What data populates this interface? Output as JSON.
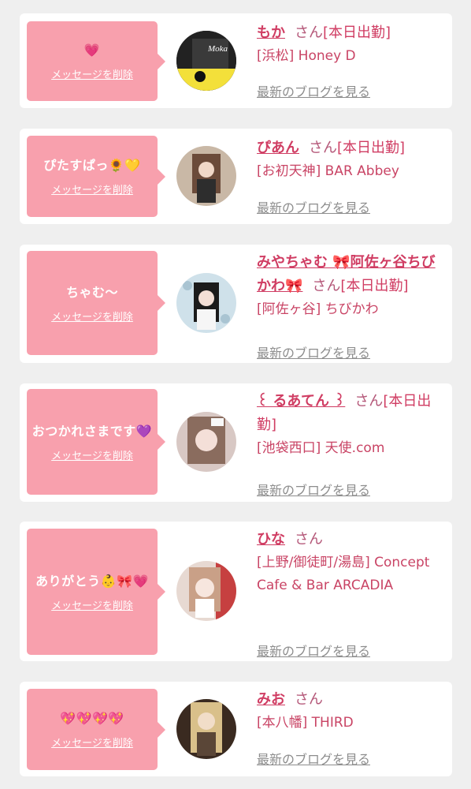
{
  "delete_label": "メッセージを削除",
  "blog_label": "最新のブログを見る",
  "san_label": "さん",
  "cards": [
    {
      "message": "💗",
      "name": "もか",
      "status": "[本日出勤]",
      "shop": "[浜松] Honey D",
      "avatar_label": "Moka"
    },
    {
      "message": "ぴたすぱっ🌻💛",
      "name": "ぴあん",
      "status": "[本日出勤]",
      "shop": "[お初天神] BAR Abbey"
    },
    {
      "message": "ちゃむ〜",
      "name": "みやちゃむ 🎀阿佐ヶ谷ちびかわ🎀",
      "status": "[本日出勤]",
      "shop": "[阿佐ヶ谷] ちびかわ"
    },
    {
      "message": "おつかれさまです💜",
      "name": "꒰ るあてん ꒱",
      "status": "[本日出勤]",
      "shop": "[池袋西口] 天使.com"
    },
    {
      "message": "ありがとう👶🎀💗",
      "name": "ひな",
      "status": "",
      "shop": "[上野/御徒町/湯島] Concept Cafe & Bar ARCADIA"
    },
    {
      "message": "💖💖💖💖",
      "name": "みお",
      "status": "",
      "shop": "[本八幡] THIRD"
    }
  ],
  "colors": {
    "background": "#efefef",
    "bubble": "#f8a0ad",
    "name": "#d03d63",
    "blog_link": "#8d8d8d"
  }
}
